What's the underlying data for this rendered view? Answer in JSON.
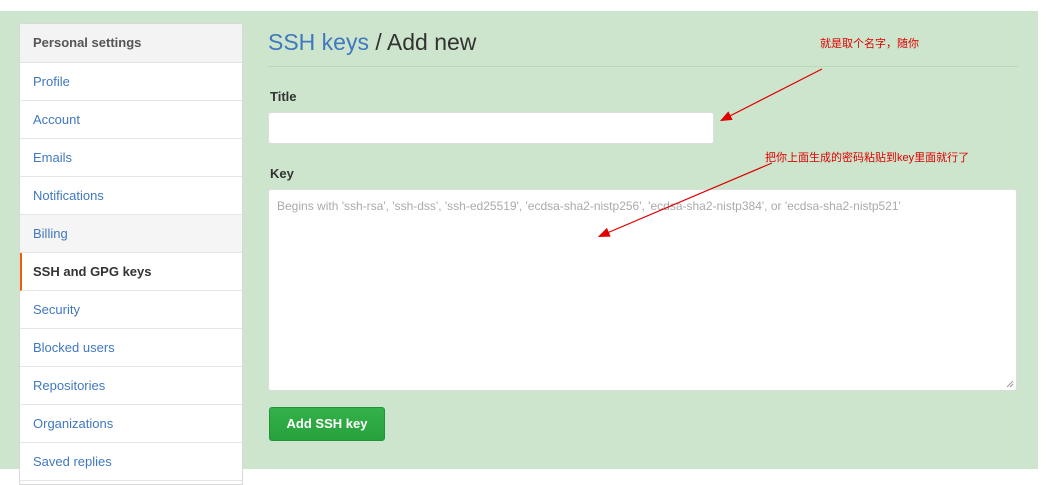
{
  "sidebar": {
    "header": "Personal settings",
    "items": [
      {
        "label": "Profile"
      },
      {
        "label": "Account"
      },
      {
        "label": "Emails"
      },
      {
        "label": "Notifications"
      },
      {
        "label": "Billing"
      },
      {
        "label": "SSH and GPG keys"
      },
      {
        "label": "Security"
      },
      {
        "label": "Blocked users"
      },
      {
        "label": "Repositories"
      },
      {
        "label": "Organizations"
      },
      {
        "label": "Saved replies"
      }
    ]
  },
  "main": {
    "breadcrumb_link": "SSH keys",
    "breadcrumb_rest": " / Add new",
    "title_label": "Title",
    "title_value": "",
    "key_label": "Key",
    "key_placeholder": "Begins with 'ssh-rsa', 'ssh-dss', 'ssh-ed25519', 'ecdsa-sha2-nistp256', 'ecdsa-sha2-nistp384', or 'ecdsa-sha2-nistp521'",
    "submit_label": "Add SSH key"
  },
  "annotations": {
    "title_note": "就是取个名字，随你",
    "key_note": "把你上面生成的密码粘贴到key里面就行了"
  },
  "colors": {
    "background": "#cce5cc",
    "link": "#4078c0",
    "button": "#2ea44f",
    "annotation": "#e00000",
    "selected_marker": "#e36209"
  }
}
